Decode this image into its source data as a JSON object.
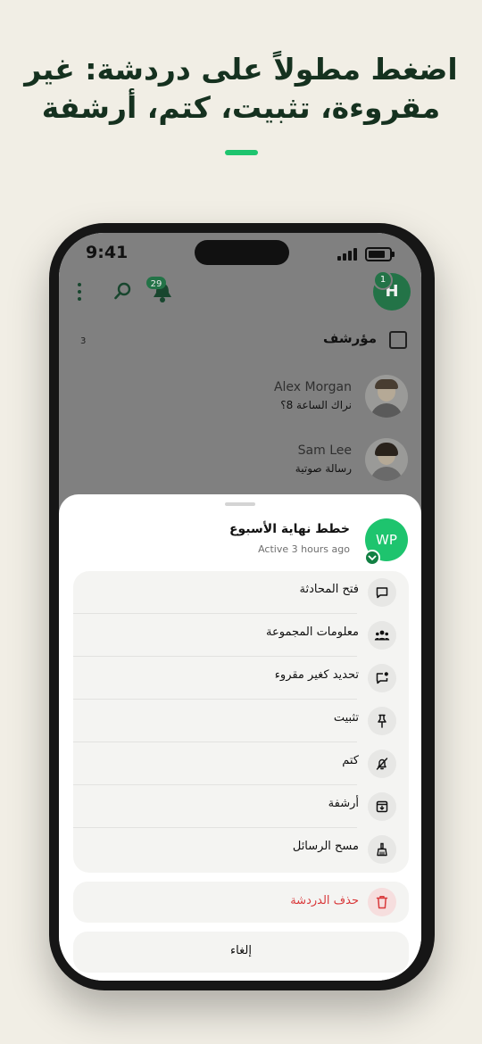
{
  "headline": {
    "line1": "اضغط مطولاً على دردشة: غير",
    "line2": "مقروءة، تثبيت، كتم، أرشفة"
  },
  "colors": {
    "background": "#f1eee5",
    "accent": "#1ec46e",
    "headline": "#15311f",
    "brand_dark": "#0f7a3f",
    "danger": "#d9393b"
  },
  "status_bar": {
    "time": "9:41"
  },
  "app_header": {
    "icons": [
      "more-vertical-icon",
      "search-icon",
      "bell-icon"
    ],
    "notification_count": "29",
    "profile_initial": "H",
    "profile_badge": "1"
  },
  "archived": {
    "label": "مؤرشف",
    "count": "3",
    "icon": "archive-icon"
  },
  "chats": [
    {
      "name": "Alex Morgan",
      "preview": "نراك الساعة 8؟"
    },
    {
      "name": "Sam Lee",
      "preview": "رسالة صوتية"
    }
  ],
  "sheet": {
    "group_initials": "WP",
    "group_name": "خطط نهاية الأسبوع",
    "subtitle": "Active 3 hours ago",
    "menu_items": [
      {
        "label": "فتح المحادثة",
        "icon": "chat-bubble-icon"
      },
      {
        "label": "معلومات المجموعة",
        "icon": "group-icon"
      },
      {
        "label": "تحديد كغير مقروء",
        "icon": "mark-unread-icon"
      },
      {
        "label": "تثبيت",
        "icon": "pin-icon"
      },
      {
        "label": "كتم",
        "icon": "mute-icon"
      },
      {
        "label": "أرشفة",
        "icon": "archive-icon"
      },
      {
        "label": "مسح الرسائل",
        "icon": "broom-icon"
      }
    ],
    "delete_label": "حذف الدردشة",
    "cancel_label": "إلغاء"
  }
}
